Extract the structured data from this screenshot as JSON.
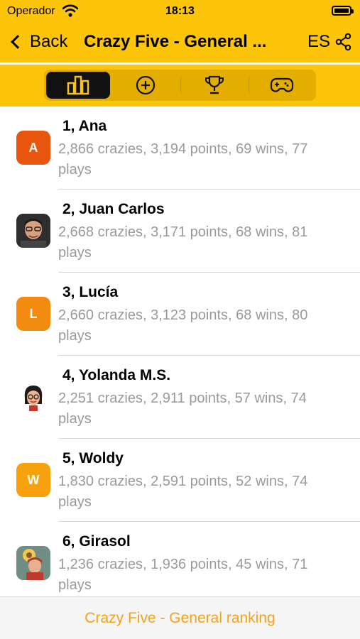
{
  "status_bar": {
    "carrier": "Operador",
    "time": "18:13"
  },
  "nav": {
    "back_label": "Back",
    "title": "Crazy Five - General ...",
    "lang": "ES"
  },
  "tabs": [
    {
      "icon": "bar-chart-icon",
      "active": true
    },
    {
      "icon": "plus-circle-icon",
      "active": false
    },
    {
      "icon": "trophy-icon",
      "active": false
    },
    {
      "icon": "gamepad-icon",
      "active": false
    }
  ],
  "players": [
    {
      "title": "1, Ana",
      "stats": "2,866 crazies, 3,194 points, 69 wins, 77 plays",
      "avatar_letter": "A",
      "avatar_color": "#E8560E"
    },
    {
      "title": "2, Juan Carlos",
      "stats": "2,668 crazies, 3,171 points, 68 wins, 81 plays",
      "avatar_letter": "",
      "avatar_color": "#3a3a3a"
    },
    {
      "title": "3, Lucía",
      "stats": "2,660 crazies, 3,123 points, 68 wins, 80 plays",
      "avatar_letter": "L",
      "avatar_color": "#F28B10"
    },
    {
      "title": "4, Yolanda M.S.",
      "stats": "2,251 crazies, 2,911 points, 57 wins, 74 plays",
      "avatar_letter": "",
      "avatar_color": "#ffffff"
    },
    {
      "title": "5, Woldy",
      "stats": "1,830 crazies, 2,591 points, 52 wins, 74 plays",
      "avatar_letter": "W",
      "avatar_color": "#F6A10D"
    },
    {
      "title": "6, Girasol",
      "stats": "1,236 crazies, 1,936 points, 45 wins, 71 plays",
      "avatar_letter": "",
      "avatar_color": "#7a9a8e"
    }
  ],
  "footer": {
    "label": "Crazy Five - General ranking"
  },
  "colors": {
    "accent": "#FCC50A",
    "footer_text": "#F1A31B"
  }
}
